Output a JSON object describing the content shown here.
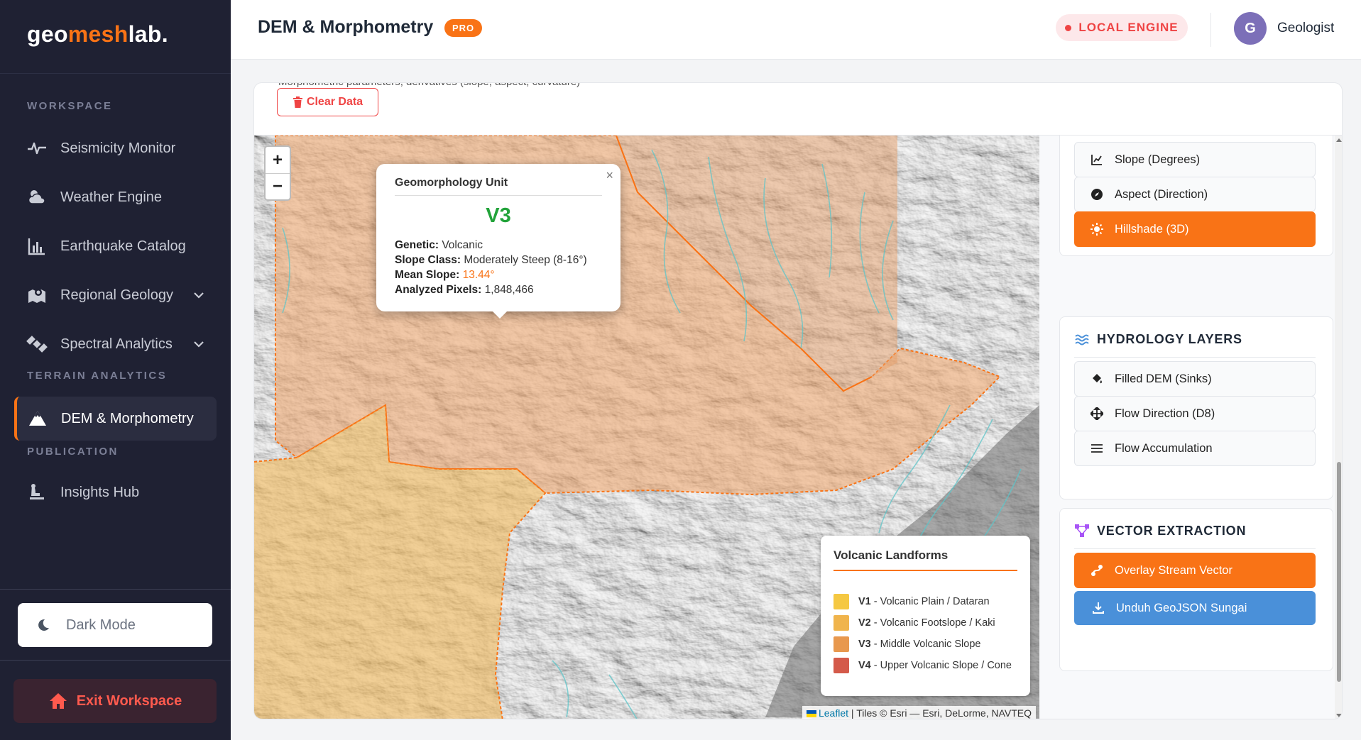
{
  "brand": {
    "part1": "geo",
    "part2": "mesh",
    "part3": "lab."
  },
  "sidebar": {
    "sections": {
      "workspace": "WORKSPACE",
      "terrain": "TERRAIN ANALYTICS",
      "publication": "PUBLICATION"
    },
    "items": [
      {
        "label": "Seismicity Monitor",
        "icon": "pulse-icon"
      },
      {
        "label": "Weather Engine",
        "icon": "cloud-sun-icon"
      },
      {
        "label": "Earthquake Catalog",
        "icon": "bar-chart-icon"
      },
      {
        "label": "Regional Geology",
        "icon": "map-marker-icon"
      },
      {
        "label": "Spectral Analytics",
        "icon": "satellite-icon"
      },
      {
        "label": "DEM & Morphometry",
        "icon": "mountain-icon"
      },
      {
        "label": "Insights Hub",
        "icon": "presentation-icon"
      }
    ],
    "dark_mode": "Dark Mode",
    "exit": "Exit Workspace"
  },
  "header": {
    "title": "DEM & Morphometry",
    "badge": "PRO",
    "engine": "LOCAL ENGINE",
    "avatar_initial": "G",
    "user": "Geologist"
  },
  "toolbar": {
    "cut_text": "Morphometric parameters, derivatives (slope, aspect, curvature)",
    "clear": "Clear Data"
  },
  "map": {
    "zoom_in": "+",
    "zoom_out": "−",
    "popup": {
      "title": "Geomorphology Unit",
      "unit": "V3",
      "genetic_label": "Genetic:",
      "genetic_value": "Volcanic",
      "slope_class_label": "Slope Class:",
      "slope_class_value": "Moderately Steep (8-16°)",
      "mean_slope_label": "Mean Slope:",
      "mean_slope_value": "13.44°",
      "pixels_label": "Analyzed Pixels:",
      "pixels_value": "1,848,466",
      "close": "×"
    },
    "legend": {
      "title": "Volcanic Landforms",
      "items": [
        {
          "code": "V1",
          "label": "- Volcanic Plain / Dataran",
          "color": "#f5c842"
        },
        {
          "code": "V2",
          "label": "- Volcanic Footslope / Kaki",
          "color": "#f0b44c"
        },
        {
          "code": "V3",
          "label": "- Middle Volcanic Slope",
          "color": "#e8984e"
        },
        {
          "code": "V4",
          "label": "- Upper Volcanic Slope / Cone",
          "color": "#d45a4a"
        }
      ]
    },
    "attribution": {
      "leaflet": "Leaflet",
      "rest": "| Tiles © Esri — Esri, DeLorme, NAVTEQ"
    }
  },
  "panel": {
    "terrain_buttons": [
      {
        "label": "Slope (Degrees)",
        "icon": "line-chart-icon",
        "active": false
      },
      {
        "label": "Aspect (Direction)",
        "icon": "compass-icon",
        "active": false
      },
      {
        "label": "Hillshade (3D)",
        "icon": "sun-icon",
        "active": true
      }
    ],
    "hydrology": {
      "title": "HYDROLOGY LAYERS",
      "buttons": [
        {
          "label": "Filled DEM (Sinks)",
          "icon": "fill-bucket-icon"
        },
        {
          "label": "Flow Direction (D8)",
          "icon": "arrows-icon"
        },
        {
          "label": "Flow Accumulation",
          "icon": "lines-icon"
        }
      ]
    },
    "vector": {
      "title": "VECTOR EXTRACTION",
      "overlay": "Overlay Stream Vector",
      "download": "Unduh GeoJSON Sungai"
    }
  },
  "colors": {
    "accent": "#f97316",
    "sidebar_bg": "#1f2133",
    "success": "#22a33a",
    "danger": "#ef4444",
    "download_blue": "#4a90d9"
  }
}
